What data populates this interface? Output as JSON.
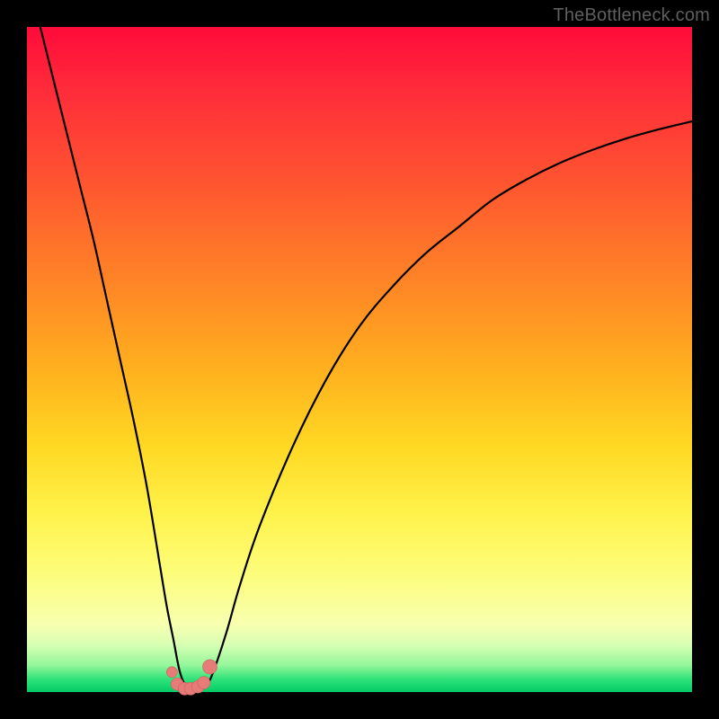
{
  "attribution": "TheBottleneck.com",
  "colors": {
    "frame": "#000000",
    "gradient_top": "#ff0b3a",
    "gradient_bottom": "#04c964",
    "curve": "#000000",
    "marker_fill": "#e77b78",
    "marker_stroke": "#c9615e"
  },
  "chart_data": {
    "type": "line",
    "title": "",
    "xlabel": "",
    "ylabel": "",
    "xlim": [
      0,
      100
    ],
    "ylim": [
      0,
      100
    ],
    "grid": false,
    "series": [
      {
        "name": "bottleneck-curve",
        "x": [
          2,
          4,
          6,
          8,
          10,
          12,
          14,
          16,
          18,
          20,
          21,
          22,
          23,
          24,
          25,
          26,
          27,
          28,
          30,
          32,
          35,
          40,
          45,
          50,
          55,
          60,
          65,
          70,
          75,
          80,
          85,
          90,
          95,
          100
        ],
        "y": [
          100,
          92,
          84,
          76,
          68,
          59,
          50,
          41,
          31,
          19,
          13,
          8,
          3,
          0.8,
          0.2,
          0.3,
          1.0,
          3,
          9,
          16,
          25,
          37,
          47,
          55,
          61,
          66,
          70,
          74,
          77,
          79.5,
          81.5,
          83.2,
          84.6,
          85.8
        ]
      }
    ],
    "markers": {
      "name": "minimum-cluster",
      "x": [
        21.8,
        22.6,
        23.7,
        24.6,
        25.7,
        26.6,
        27.5
      ],
      "y": [
        3.0,
        1.2,
        0.5,
        0.5,
        0.8,
        1.4,
        3.8
      ],
      "r": [
        6,
        7,
        7,
        7,
        7,
        7,
        8
      ]
    }
  }
}
